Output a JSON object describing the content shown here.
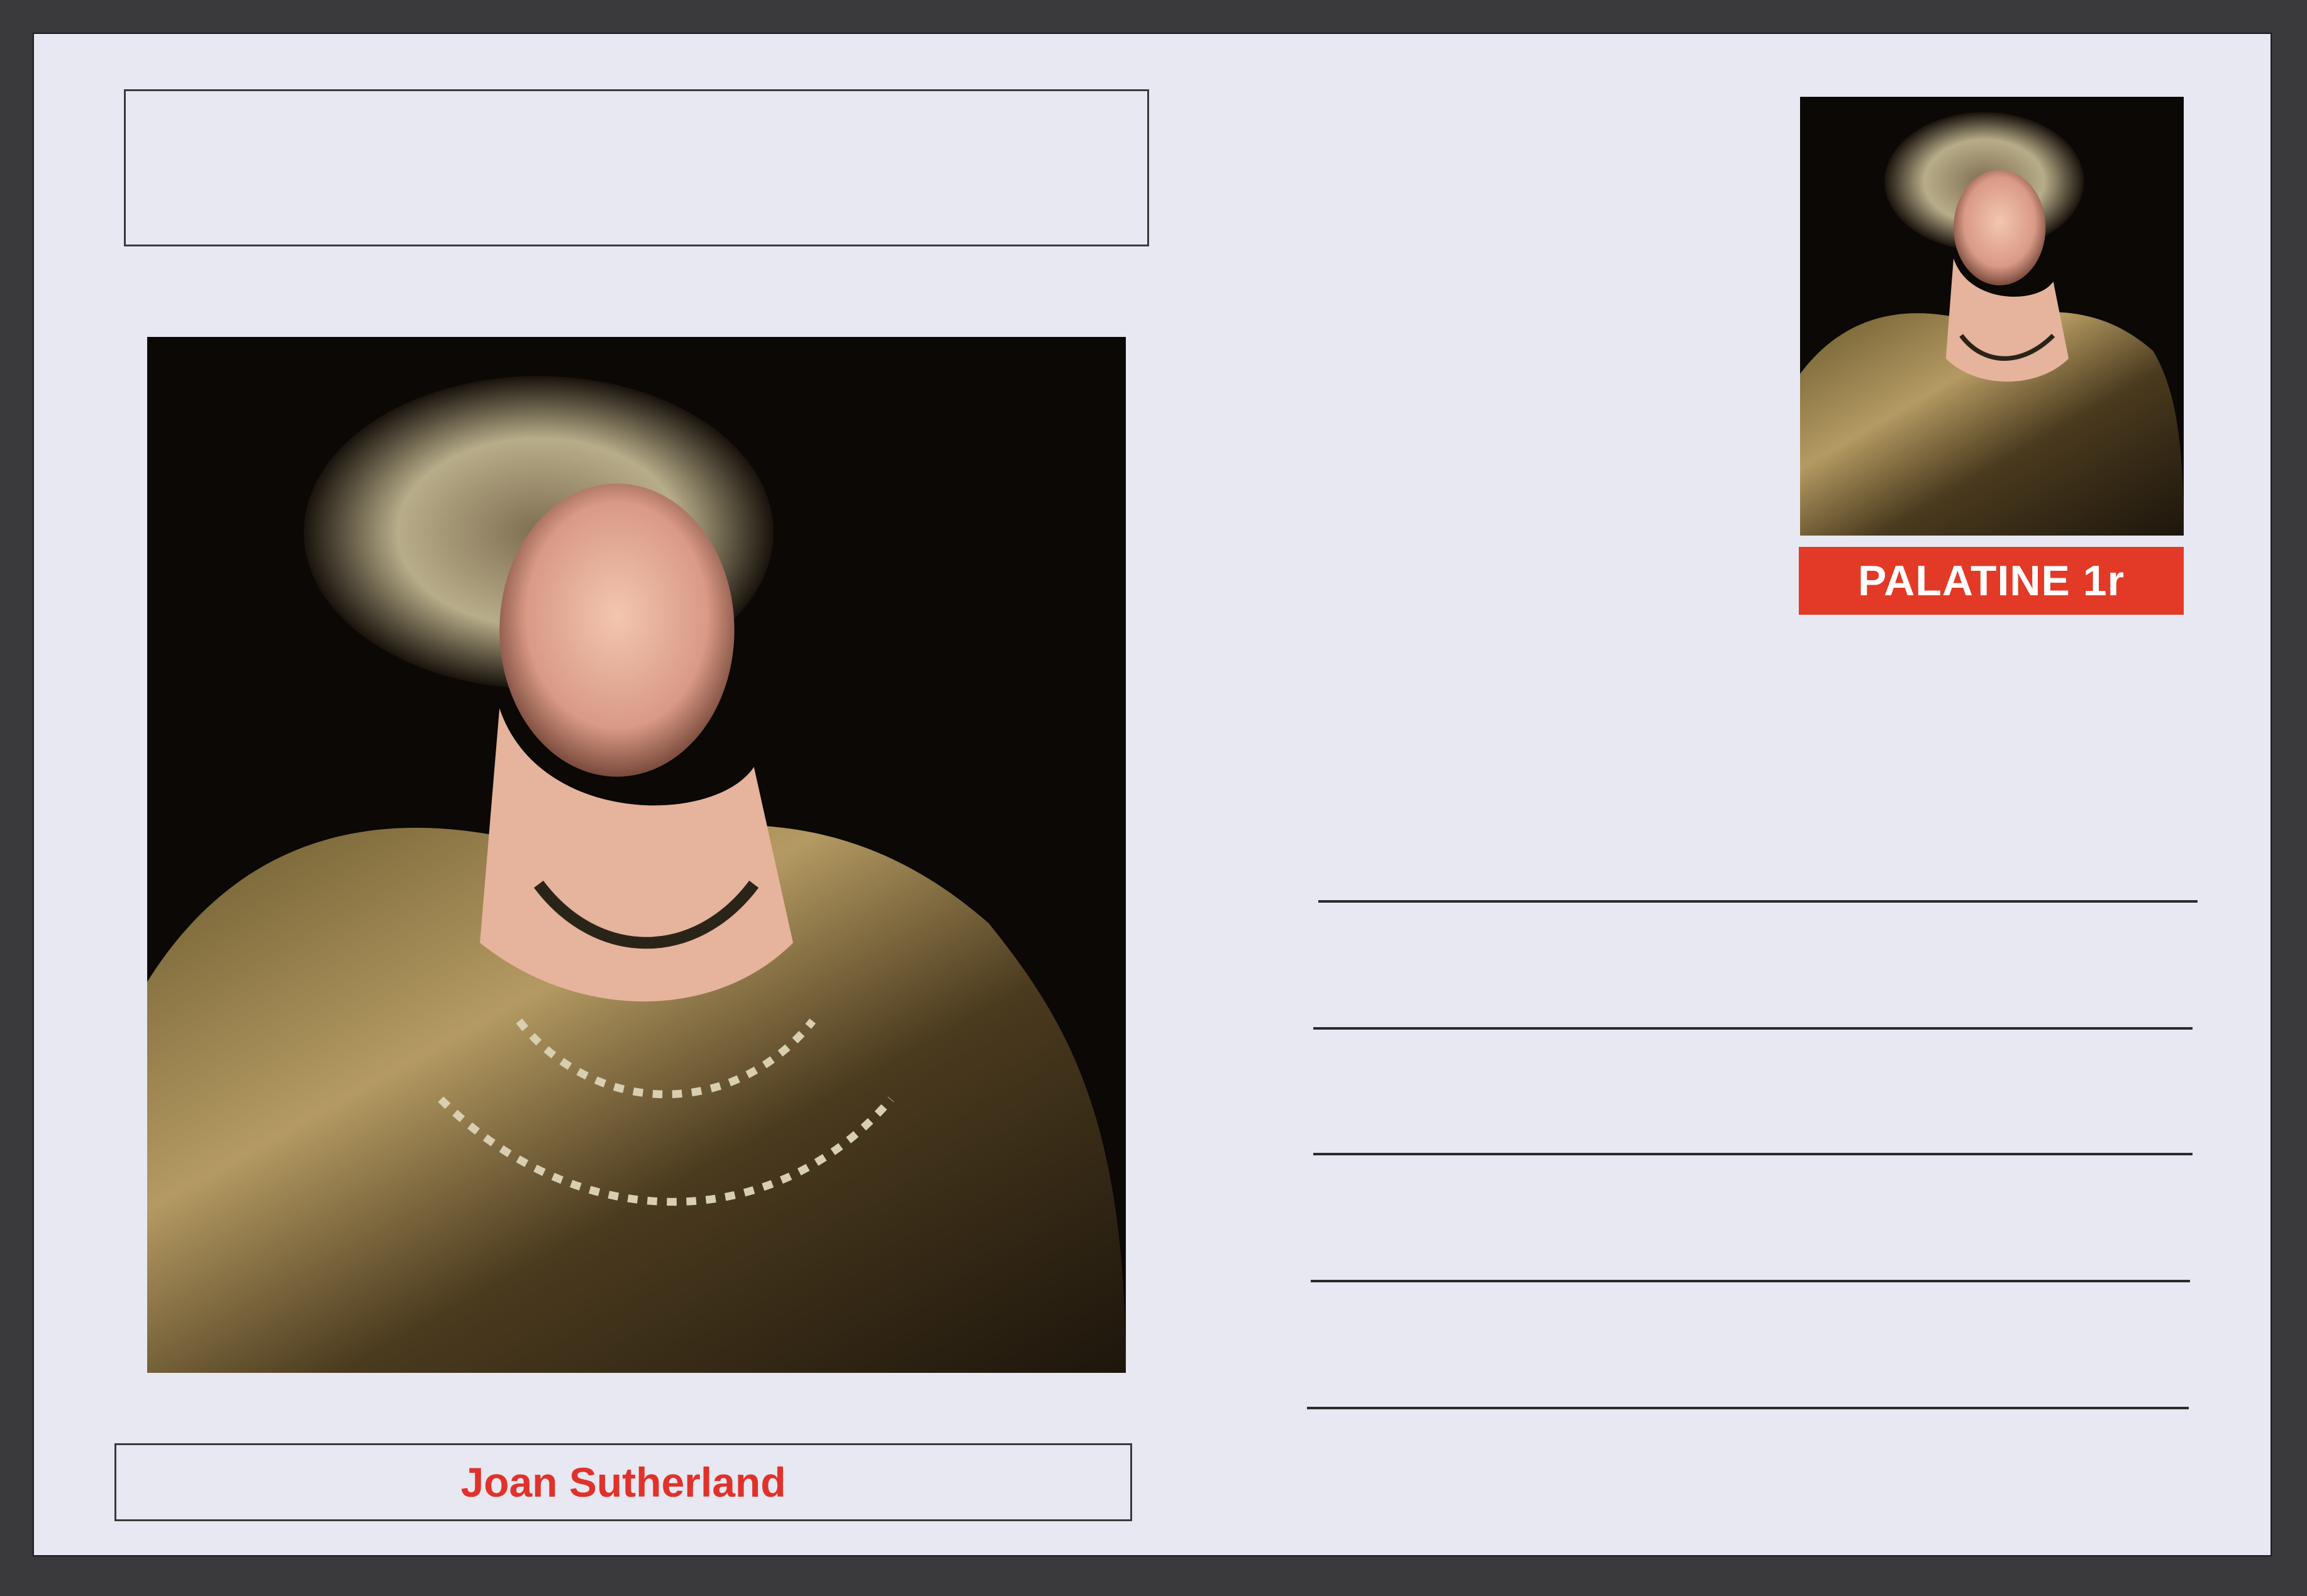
{
  "card": {
    "portrait_name": "Joan Sutherland",
    "stamp_text": "PALATINE 1r",
    "photo_subject": "opera-singer-portrait",
    "accent_color": "#e23a26"
  }
}
